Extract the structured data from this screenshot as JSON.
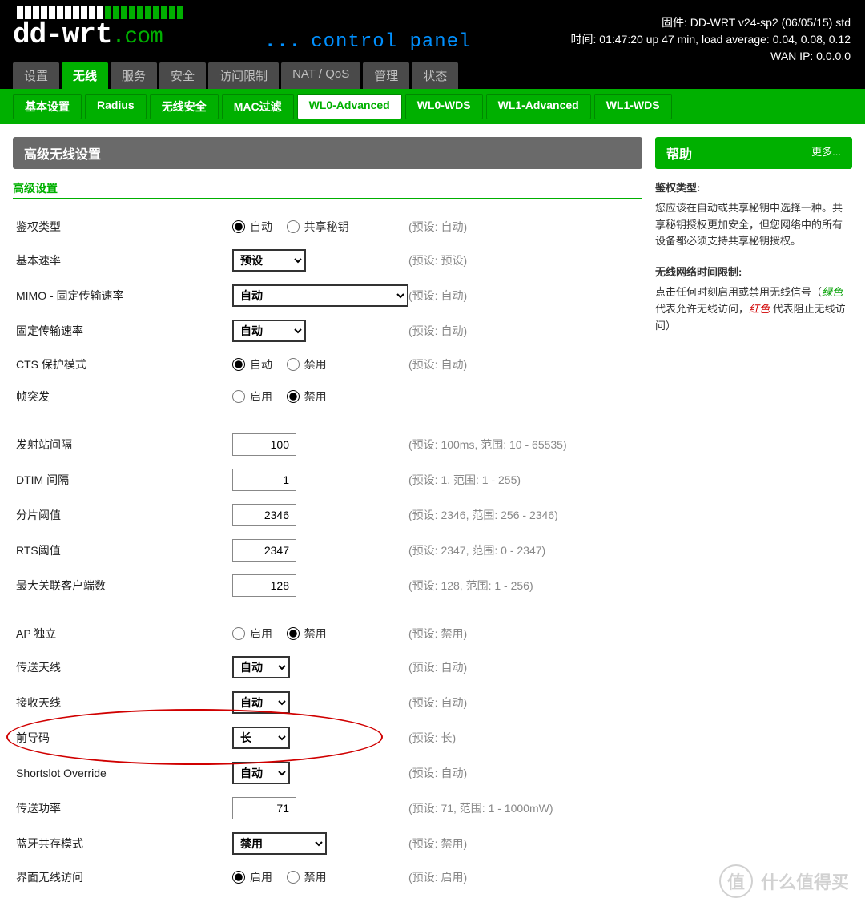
{
  "header": {
    "firmware": "固件: DD-WRT v24-sp2 (06/05/15) std",
    "time": "时间: 01:47:20 up 47 min, load average: 0.04, 0.08, 0.12",
    "wan": "WAN IP: 0.0.0.0",
    "control_panel": "control panel"
  },
  "mainnav": {
    "items": [
      {
        "label": "设置"
      },
      {
        "label": "无线",
        "active": true
      },
      {
        "label": "服务"
      },
      {
        "label": "安全"
      },
      {
        "label": "访问限制"
      },
      {
        "label": "NAT / QoS"
      },
      {
        "label": "管理"
      },
      {
        "label": "状态"
      }
    ]
  },
  "subnav": {
    "items": [
      {
        "label": "基本设置"
      },
      {
        "label": "Radius"
      },
      {
        "label": "无线安全"
      },
      {
        "label": "MAC过滤"
      },
      {
        "label": "WL0-Advanced",
        "active": true
      },
      {
        "label": "WL0-WDS"
      },
      {
        "label": "WL1-Advanced"
      },
      {
        "label": "WL1-WDS"
      }
    ]
  },
  "panel": {
    "title": "高级无线设置",
    "section": "高级设置"
  },
  "rows": {
    "auth": {
      "label": "鉴权类型",
      "opt1": "自动",
      "opt2": "共享秘钥",
      "hint": "(预设: 自动)"
    },
    "baserate": {
      "label": "基本速率",
      "value": "预设",
      "hint": "(预设: 预设)"
    },
    "mimo": {
      "label": "MIMO - 固定传输速率",
      "value": "自动",
      "hint": "(预设: 自动)"
    },
    "fixrate": {
      "label": "固定传输速率",
      "value": "自动",
      "hint": "(预设: 自动)"
    },
    "cts": {
      "label": "CTS 保护模式",
      "opt1": "自动",
      "opt2": "禁用",
      "hint": "(预设: 自动)"
    },
    "burst": {
      "label": "帧突发",
      "opt1": "启用",
      "opt2": "禁用"
    },
    "beacon": {
      "label": "发射站间隔",
      "value": "100",
      "hint": "(预设: 100ms, 范围: 10 - 65535)"
    },
    "dtim": {
      "label": "DTIM 间隔",
      "value": "1",
      "hint": "(预设: 1, 范围: 1 - 255)"
    },
    "frag": {
      "label": "分片阈值",
      "value": "2346",
      "hint": "(预设: 2346, 范围: 256 - 2346)"
    },
    "rts": {
      "label": "RTS阈值",
      "value": "2347",
      "hint": "(预设: 2347, 范围: 0 - 2347)"
    },
    "maxassoc": {
      "label": "最大关联客户端数",
      "value": "128",
      "hint": "(预设: 128, 范围: 1 - 256)"
    },
    "apisolate": {
      "label": "AP 独立",
      "opt1": "启用",
      "opt2": "禁用",
      "hint": "(预设: 禁用)"
    },
    "txant": {
      "label": "传送天线",
      "value": "自动",
      "hint": "(预设: 自动)"
    },
    "rxant": {
      "label": "接收天线",
      "value": "自动",
      "hint": "(预设: 自动)"
    },
    "preamble": {
      "label": "前导码",
      "value": "长",
      "hint": "(预设: 长)"
    },
    "shortslot": {
      "label": "Shortslot Override",
      "value": "自动",
      "hint": "(预设: 自动)"
    },
    "txpower": {
      "label": "传送功率",
      "value": "71",
      "hint": "(预设: 71, 范围: 1 - 1000mW)"
    },
    "btcoex": {
      "label": "蓝牙共存模式",
      "value": "禁用",
      "hint": "(预设: 禁用)"
    },
    "webgui": {
      "label": "界面无线访问",
      "opt1": "启用",
      "opt2": "禁用",
      "hint": "(预设: 启用)"
    }
  },
  "help": {
    "title": "帮助",
    "more": "更多...",
    "h1": "鉴权类型:",
    "p1": "您应该在自动或共享秘钥中选择一种。共享秘钥授权更加安全，但您网络中的所有设备都必须支持共享秘钥授权。",
    "h2": "无线网络时间限制:",
    "p2a": "点击任何时刻启用或禁用无线信号（",
    "p2g": "绿色",
    "p2b": " 代表允许无线访问，",
    "p2r": "红色",
    "p2c": " 代表阻止无线访问）"
  },
  "watermark": "什么值得买"
}
